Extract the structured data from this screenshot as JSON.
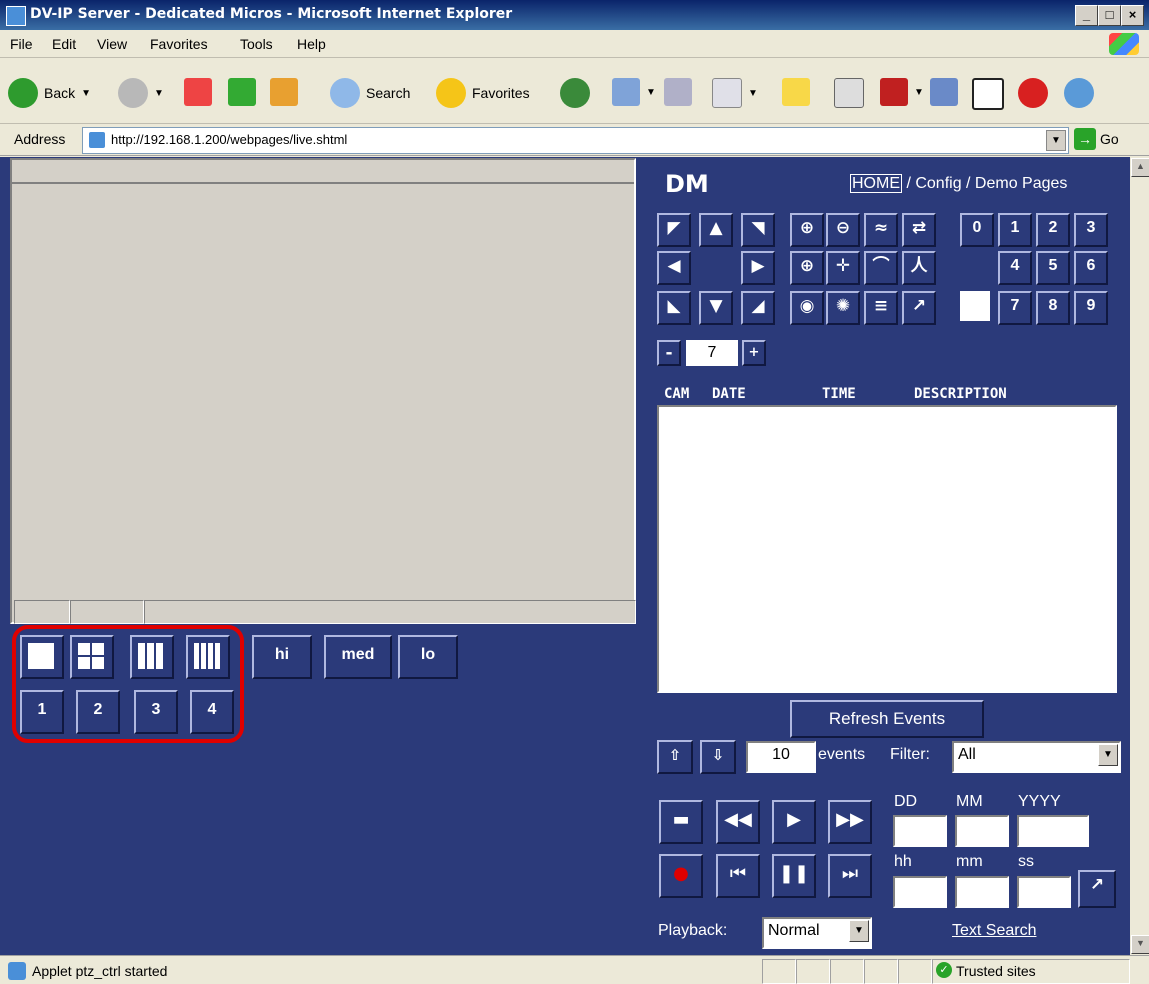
{
  "window": {
    "title": "DV-IP Server - Dedicated Micros - Microsoft Internet Explorer"
  },
  "menu": [
    "File",
    "Edit",
    "View",
    "Favorites",
    "Tools",
    "Help"
  ],
  "toolbar": {
    "back": "Back",
    "search": "Search",
    "favorites": "Favorites"
  },
  "address": {
    "label": "Address",
    "url": "http://192.168.1.200/webpages/live.shtml",
    "go": "Go"
  },
  "header": {
    "logo": "DM",
    "home": "HOME",
    "crumb_rest": " / Config / Demo Pages"
  },
  "layout_buttons": {
    "hi": "hi",
    "med": "med",
    "lo": "lo"
  },
  "camera_buttons": [
    "1",
    "2",
    "3",
    "4"
  ],
  "numpad": [
    "0",
    "1",
    "2",
    "3",
    "4",
    "5",
    "6",
    "7",
    "8",
    "9"
  ],
  "zoom": {
    "minus": "-",
    "value": "7",
    "plus": "+"
  },
  "events": {
    "columns": [
      "CAM",
      "DATE",
      "TIME",
      "DESCRIPTION"
    ],
    "refresh": "Refresh Events",
    "count": "10",
    "count_label": "events",
    "filter_label": "Filter:",
    "filter_value": "All"
  },
  "datetime": {
    "dd": "DD",
    "mm": "MM",
    "yyyy": "YYYY",
    "hh": "hh",
    "min": "mm",
    "ss": "ss"
  },
  "playback": {
    "label": "Playback:",
    "value": "Normal",
    "text_search": "Text Search"
  },
  "status": {
    "text": "Applet ptz_ctrl started",
    "zone": "Trusted sites"
  },
  "colors": {
    "panel_bg": "#2b3a7a",
    "highlight": "#e00000"
  }
}
